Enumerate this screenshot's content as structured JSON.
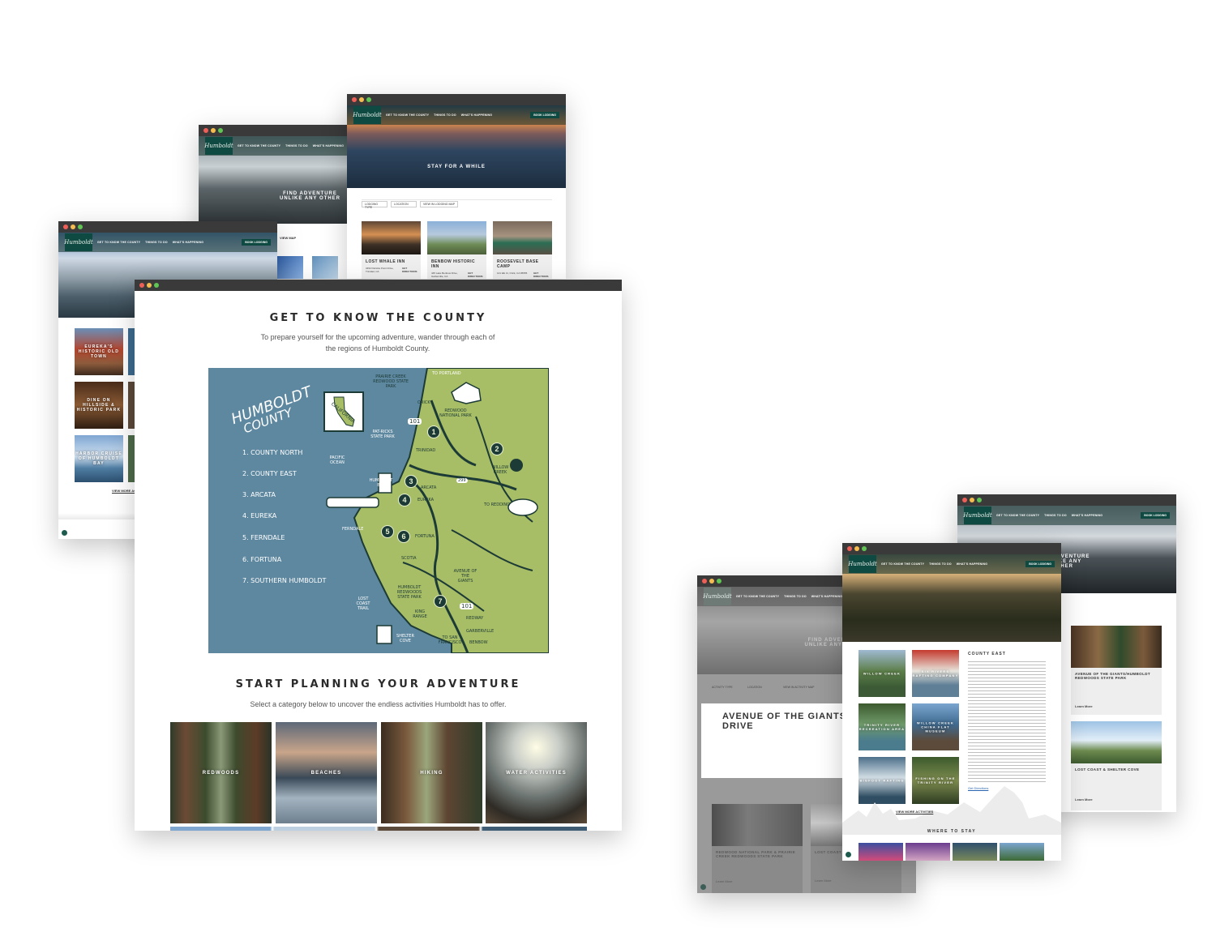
{
  "site": {
    "logo": "Humboldt",
    "nav": [
      "GET TO KNOW THE COUNTY",
      "THINGS TO DO",
      "WHAT'S HAPPENING"
    ],
    "book": "BOOK LODGING"
  },
  "win_lodging": {
    "hero": "STAY FOR A WHILE",
    "filters": [
      "LODGING TYPE",
      "LOCATION",
      "VIEW IN LODGING MAP"
    ],
    "cards": [
      {
        "name": "LOST WHALE INN",
        "addr": "3452 Patricks Point Drive, Trinidad, CA",
        "dir": "GET DIRECTIONS"
      },
      {
        "name": "BENBOW HISTORIC INN",
        "addr": "445 Lake Benbow Drive, Garberville, CA",
        "dir": "GET DIRECTIONS"
      },
      {
        "name": "ROOSEVELT BASE CAMP",
        "addr": "121 Elk Ct, Orick, CA 95555",
        "dir": "GET DIRECTIONS"
      }
    ]
  },
  "win_adventure": {
    "hero": "FIND ADVENTURE UNLIKE ANY OTHER",
    "map_link": "VIEW MAP"
  },
  "win_harbor": {
    "tiles": [
      "EUREKA'S HISTORIC OLD TOWN",
      "DINE ON HILLSIDE & HISTORIC PARK",
      "HARBOR CRUISE OF HUMBOLDT BAY"
    ],
    "more": "VIEW MORE ACTIVITIES"
  },
  "main": {
    "title": "GET TO KNOW THE COUNTY",
    "intro": "To prepare yourself for the upcoming adventure, wander through each of the regions of Humboldt County.",
    "map": {
      "title_line1": "HUMBOLDT",
      "title_line2": "COUNTY",
      "california": "CALIFORNIA",
      "regions": [
        "1. COUNTY NORTH",
        "2. COUNTY EAST",
        "3. ARCATA",
        "4. EUREKA",
        "5. FERNDALE",
        "6. FORTUNA",
        "7. SOUTHERN HUMBOLDT"
      ],
      "places": {
        "prairie": "PRAIRIE CREEK REDWOOD STATE PARK",
        "portland": "TO PORTLAND",
        "orick": "ORICK",
        "redwood": "REDWOOD NATIONAL PARK",
        "patricks": "PAT-RICKS STATE PARK",
        "trinidad": "TRINIDAD",
        "pacific": "PACIFIC OCEAN",
        "willow": "WILLOW CREEK",
        "bay": "HUMBOLDT BAY",
        "arcata": "ARCATA",
        "eureka": "EUREKA",
        "redding": "TO REDDING",
        "ferndale": "FERNDALE",
        "fortuna": "FORTUNA",
        "scotia": "SCOTIA",
        "hsp": "HUMBOLDT REDWOODS STATE PARK",
        "avenue": "AVENUE OF THE GIANTS",
        "lostcoast": "LOST COAST TRAIL",
        "king": "KING RANGE",
        "redway": "REDWAY",
        "garberville": "GARBERVILLE",
        "shelter": "SHELTER COVE",
        "sf": "TO SAN FRANCISCO",
        "benbow": "BENBOW",
        "hwy101": "101",
        "hwy299": "299"
      }
    },
    "planning_title": "START PLANNING YOUR ADVENTURE",
    "planning_sub": "Select a category below to uncover the endless activities Humboldt has to offer.",
    "categories": [
      "REDWOODS",
      "BEACHES",
      "HIKING",
      "WATER ACTIVITIES"
    ]
  },
  "win_drive": {
    "heading": "AVENUE OF THE GIANTS SCENIC DRIVE",
    "filters": [
      "ACTIVITY TYPE",
      "LOCATION",
      "VIEW IN ACTIVITY MAP"
    ],
    "hero": "FIND ADVENTURE UNLIKE ANY OTHER",
    "cards": [
      {
        "name": "REDWOOD NATIONAL PARK & PRAIRIE CREEK REDWOODS STATE PARK",
        "link": "Learn More"
      },
      {
        "name": "LOST COAST",
        "link": "Learn More"
      }
    ]
  },
  "win_east": {
    "section": "COUNTY EAST",
    "tiles": [
      "WILLOW CREEK",
      "SIX RIVERS RAFTING COMPANY",
      "TRINITY RIVER RECREATION AREA",
      "WILLOW CREEK CHINA FLAT MUSEUM",
      "BIGFOOT RAFTING",
      "FISHING ON THE TRINITY RIVER"
    ],
    "directions": "Get Directions",
    "more": "VIEW MORE ACTIVITIES",
    "stay": "WHERE TO STAY"
  },
  "win_right": {
    "hero": "FIND ADVENTURE UNLIKE ANY OTHER",
    "cards": [
      {
        "name": "AVENUE OF THE GIANTS/HUMBOLDT REDWOODS STATE PARK",
        "link": "Learn More"
      },
      {
        "name": "LOST COAST & SHELTER COVE",
        "link": "Learn More"
      }
    ]
  }
}
